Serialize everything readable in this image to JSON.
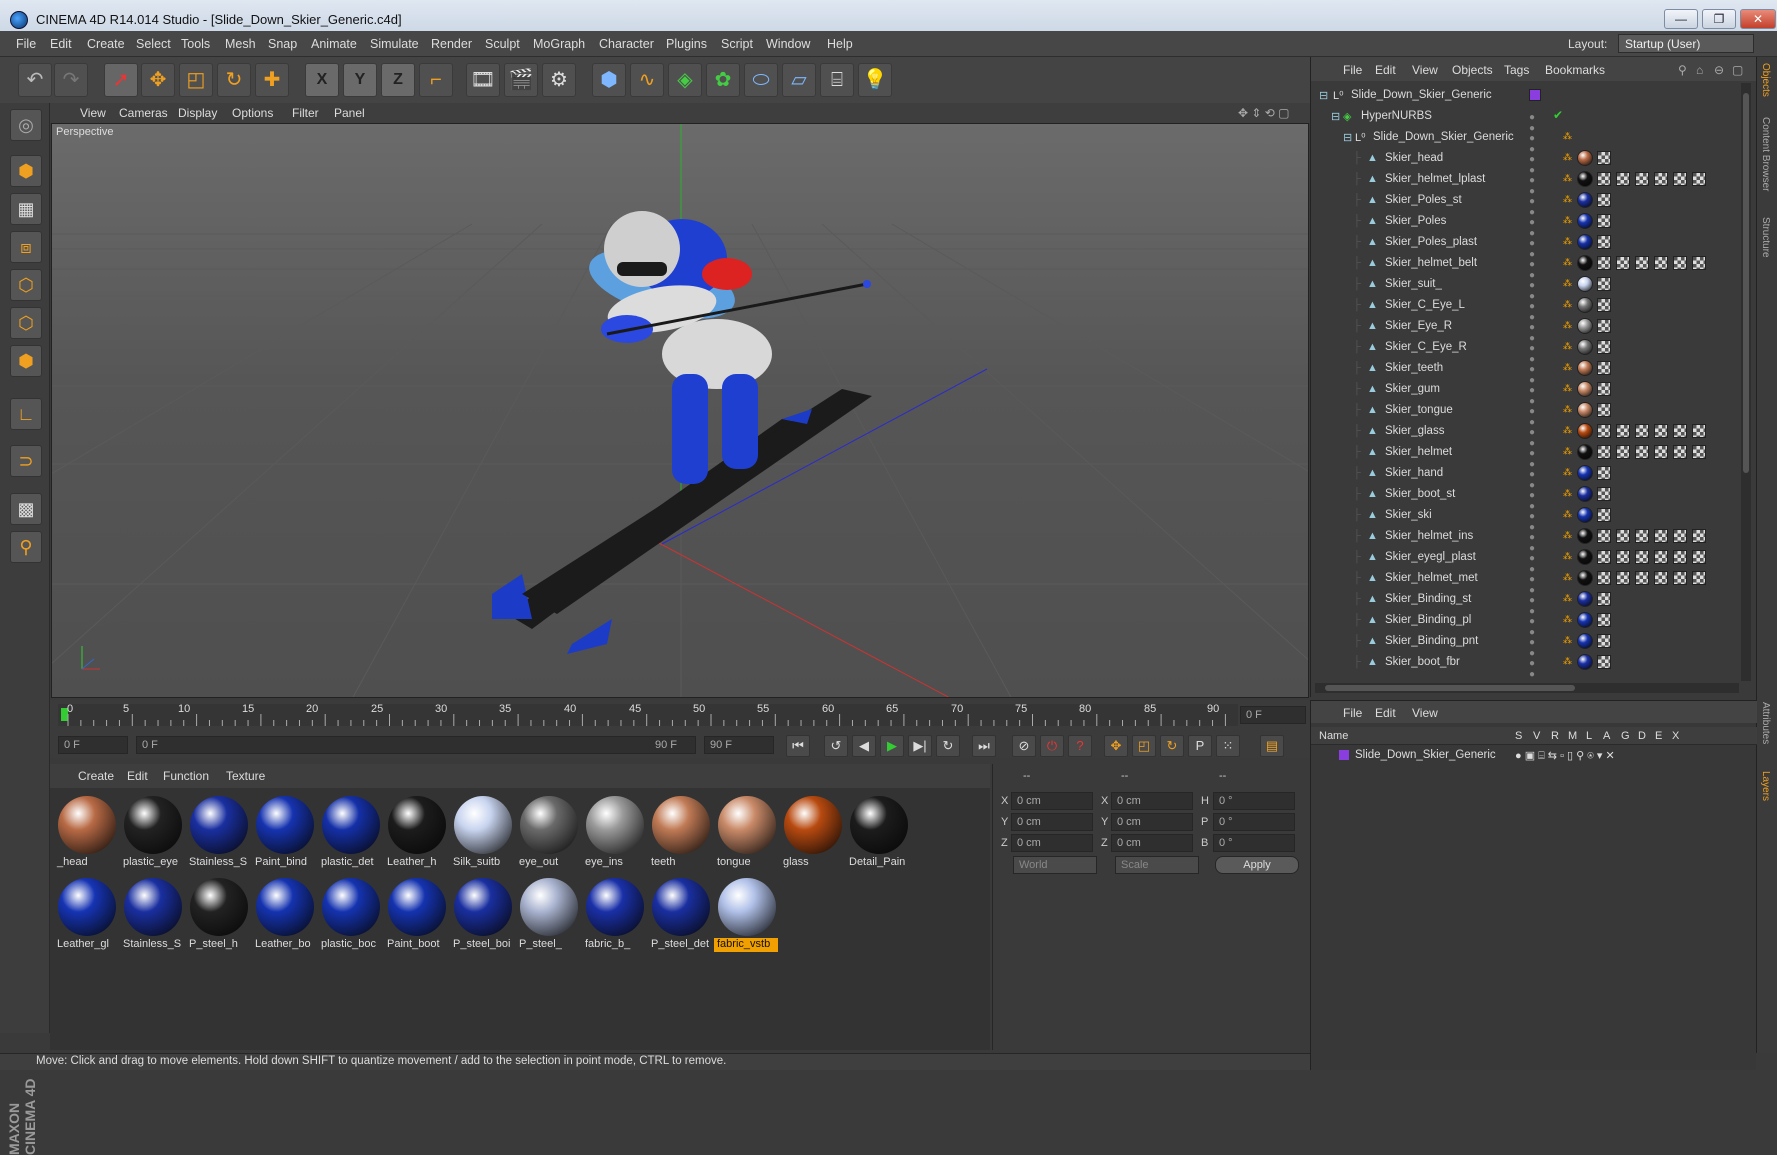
{
  "window": {
    "title": "CINEMA 4D R14.014 Studio - [Slide_Down_Skier_Generic.c4d]",
    "minimize": "—",
    "maximize": "❐",
    "close": "✕"
  },
  "menubar": {
    "items": [
      "File",
      "Edit",
      "Create",
      "Select",
      "Tools",
      "Mesh",
      "Snap",
      "Animate",
      "Simulate",
      "Render",
      "Sculpt",
      "MoGraph",
      "Character",
      "Plugins",
      "Script",
      "Window",
      "Help"
    ],
    "layout_label": "Layout:",
    "layout_value": "Startup (User)"
  },
  "toolbar": {
    "icons": [
      "undo-icon",
      "redo-icon",
      "live-select-icon",
      "move-icon",
      "scale-icon",
      "rotate-icon",
      "add-icon",
      "x-axis-icon",
      "y-axis-icon",
      "z-axis-icon",
      "coordinate-system-icon",
      "render-view-icon",
      "render-picture-viewer-icon",
      "edit-render-settings-icon",
      "cube-icon",
      "spline-icon",
      "nurbs-icon",
      "array-icon",
      "deformer-icon",
      "floor-icon",
      "camera-icon",
      "light-icon"
    ],
    "x": "X",
    "y": "Y",
    "z": "Z"
  },
  "viewport": {
    "menu": [
      "View",
      "Cameras",
      "Display",
      "Options",
      "Filter",
      "Panel"
    ],
    "label": "Perspective"
  },
  "timeline": {
    "ticks": [
      "0",
      "5",
      "10",
      "15",
      "20",
      "25",
      "30",
      "35",
      "40",
      "45",
      "50",
      "55",
      "60",
      "65",
      "70",
      "75",
      "80",
      "85",
      "90"
    ],
    "current_frame": "0 F",
    "start": "0 F",
    "range_start": "0 F",
    "range_end": "90 F",
    "end": "90 F"
  },
  "materials": {
    "menu": [
      "Create",
      "Edit",
      "Function",
      "Texture"
    ],
    "row1": [
      {
        "name": "_head",
        "color": "#b86a45"
      },
      {
        "name": "plastic_eye",
        "color": "#222"
      },
      {
        "name": "Stainless_S",
        "color": "#1a2fa0"
      },
      {
        "name": "Paint_bind",
        "color": "#1633b0"
      },
      {
        "name": "plastic_det",
        "color": "#1530a8"
      },
      {
        "name": "Leather_h",
        "color": "#1c1c1c"
      },
      {
        "name": "Silk_suitb",
        "color": "#c8d4ef"
      },
      {
        "name": "eye_out",
        "color": "#6a6a6a"
      },
      {
        "name": "eye_ins",
        "color": "#9a9a9a"
      },
      {
        "name": "teeth",
        "color": "#c07a55"
      },
      {
        "name": "tongue",
        "color": "#c98a68"
      },
      {
        "name": "glass",
        "color": "#b84a10"
      },
      {
        "name": "Detail_Pain",
        "color": "#1c1c1c"
      }
    ],
    "row2": [
      {
        "name": "Leather_gl",
        "color": "#1634b4"
      },
      {
        "name": "Stainless_S",
        "color": "#1a2fa0"
      },
      {
        "name": "P_steel_h",
        "color": "#222"
      },
      {
        "name": "Leather_bo",
        "color": "#1533b0"
      },
      {
        "name": "plastic_boc",
        "color": "#1533b0"
      },
      {
        "name": "Paint_boot",
        "color": "#1533b0"
      },
      {
        "name": "P_steel_boi",
        "color": "#1a2fa0"
      },
      {
        "name": "P_steel_",
        "color": "#aab4d0"
      },
      {
        "name": "fabric_b_",
        "color": "#1a30a8"
      },
      {
        "name": "P_steel_det",
        "color": "#1a2fa0"
      },
      {
        "name": "fabric_vstb",
        "color": "#b0c0e8"
      }
    ],
    "selected": "fabric_vstb"
  },
  "coordinates": {
    "headers": [
      "--",
      "--",
      "--"
    ],
    "rows": [
      {
        "a": "X",
        "av": "0 cm",
        "b": "X",
        "bv": "0 cm",
        "c": "H",
        "cv": "0 °"
      },
      {
        "a": "Y",
        "av": "0 cm",
        "b": "Y",
        "bv": "0 cm",
        "c": "P",
        "cv": "0 °"
      },
      {
        "a": "Z",
        "av": "0 cm",
        "b": "Z",
        "bv": "0 cm",
        "c": "B",
        "cv": "0 °"
      }
    ],
    "world": "World",
    "scale": "Scale",
    "apply": "Apply"
  },
  "status": "Move: Click and drag to move elements. Hold down SHIFT to quantize movement / add to the selection in point mode, CTRL to remove.",
  "objects_panel": {
    "menu": [
      "File",
      "Edit",
      "View",
      "Objects",
      "Tags",
      "Bookmarks"
    ],
    "root": "Slide_Down_Skier_Generic",
    "nurbs": "HyperNURBS",
    "group": "Slide_Down_Skier_Generic",
    "items": [
      {
        "name": "Skier_head",
        "tag": "#b86a45",
        "checks": 1
      },
      {
        "name": "Skier_helmet_lplast",
        "tag": "#111",
        "checks": 6
      },
      {
        "name": "Skier_Poles_st",
        "tag": "#1a2fa0",
        "checks": 1
      },
      {
        "name": "Skier_Poles",
        "tag": "#1633b0",
        "checks": 1
      },
      {
        "name": "Skier_Poles_plast",
        "tag": "#1530a8",
        "checks": 1
      },
      {
        "name": "Skier_helmet_belt",
        "tag": "#111",
        "checks": 6
      },
      {
        "name": "Skier_suit_",
        "tag": "#c8d4ef",
        "checks": 1
      },
      {
        "name": "Skier_C_Eye_L",
        "tag": "#777",
        "checks": 1
      },
      {
        "name": "Skier_Eye_R",
        "tag": "#999",
        "checks": 1
      },
      {
        "name": "Skier_C_Eye_R",
        "tag": "#777",
        "checks": 1
      },
      {
        "name": "Skier_teeth",
        "tag": "#c07a55",
        "checks": 1
      },
      {
        "name": "Skier_gum",
        "tag": "#c98a68",
        "checks": 1
      },
      {
        "name": "Skier_tongue",
        "tag": "#c98a68",
        "checks": 1
      },
      {
        "name": "Skier_glass",
        "tag": "#b84a10",
        "checks": 6
      },
      {
        "name": "Skier_helmet",
        "tag": "#111",
        "checks": 6
      },
      {
        "name": "Skier_hand",
        "tag": "#1634b4",
        "checks": 1
      },
      {
        "name": "Skier_boot_st",
        "tag": "#1a2fa0",
        "checks": 1
      },
      {
        "name": "Skier_ski",
        "tag": "#1533b0",
        "checks": 1
      },
      {
        "name": "Skier_helmet_ins",
        "tag": "#111",
        "checks": 6
      },
      {
        "name": "Skier_eyegl_plast",
        "tag": "#111",
        "checks": 6
      },
      {
        "name": "Skier_helmet_met",
        "tag": "#111",
        "checks": 6
      },
      {
        "name": "Skier_Binding_st",
        "tag": "#1a2fa0",
        "checks": 1
      },
      {
        "name": "Skier_Binding_pl",
        "tag": "#1533b0",
        "checks": 1
      },
      {
        "name": "Skier_Binding_pnt",
        "tag": "#1533b0",
        "checks": 1
      },
      {
        "name": "Skier_boot_fbr",
        "tag": "#1a30a8",
        "checks": 1
      }
    ]
  },
  "side_tabs": [
    "Objects",
    "Content Browser",
    "Structure",
    "Attributes",
    "Layers"
  ],
  "layers_panel": {
    "menu": [
      "File",
      "Edit",
      "View"
    ],
    "headers": [
      "Name",
      "S",
      "V",
      "R",
      "M",
      "L",
      "A",
      "G",
      "D",
      "E",
      "X"
    ],
    "row": "Slide_Down_Skier_Generic"
  }
}
